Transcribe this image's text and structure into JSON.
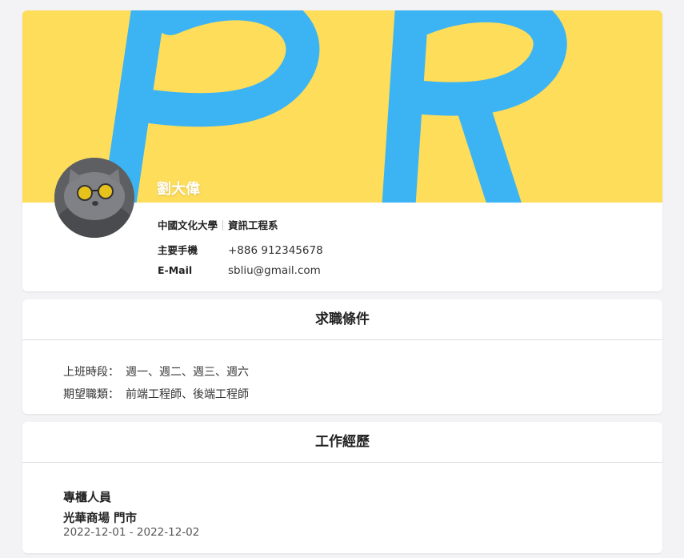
{
  "profile": {
    "name": "劉大偉",
    "school": "中國文化大學",
    "department": "資訊工程系",
    "phone_label": "主要手機",
    "phone": "+886 912345678",
    "email_label": "E-Mail",
    "email": "sbliu@gmail.com",
    "banner_colors": {
      "background": "#fedd5a",
      "letters": "#3cb4f4"
    }
  },
  "job_conditions": {
    "title": "求職條件",
    "items": [
      {
        "label": "上班時段：",
        "value": "週一、週二、週三、週六"
      },
      {
        "label": "期望職類：",
        "value": "前端工程師、後端工程師"
      }
    ]
  },
  "work_experience": {
    "title": "工作經歷",
    "entries": [
      {
        "position": "專櫃人員",
        "company": "光華商場 門市",
        "period": "2022-12-01 - 2022-12-02"
      }
    ]
  }
}
